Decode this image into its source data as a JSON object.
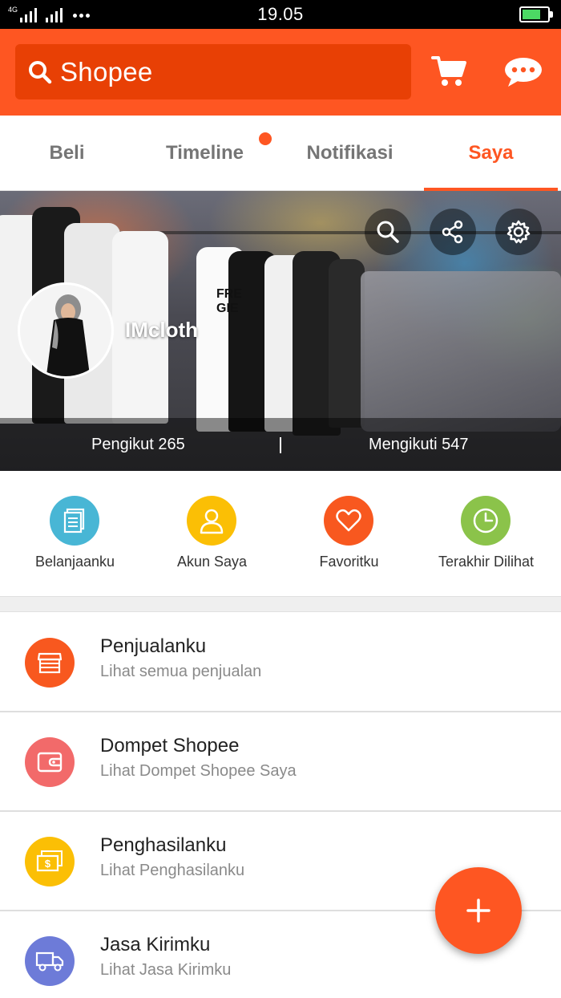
{
  "status_bar": {
    "network": "4G",
    "time": "19.05"
  },
  "header": {
    "search_label": "Shopee"
  },
  "tabs": [
    {
      "label": "Beli"
    },
    {
      "label": "Timeline"
    },
    {
      "label": "Notifikasi"
    },
    {
      "label": "Saya"
    }
  ],
  "profile": {
    "shop_name": "IMcloth",
    "followers": "Pengikut 265",
    "following": "Mengikuti 547"
  },
  "quick_actions": [
    {
      "label": "Belanjaanku",
      "icon": "document-icon",
      "color": "#48b6d5"
    },
    {
      "label": "Akun Saya",
      "icon": "person-icon",
      "color": "#fbbf05"
    },
    {
      "label": "Favoritku",
      "icon": "heart-icon",
      "color": "#f8581f"
    },
    {
      "label": "Terakhir Dilihat",
      "icon": "clock-icon",
      "color": "#8bc34a"
    }
  ],
  "menu": [
    {
      "title": "Penjualanku",
      "subtitle": "Lihat semua penjualan",
      "icon": "shop-icon",
      "color": "#f8581f"
    },
    {
      "title": "Dompet Shopee",
      "subtitle": "Lihat Dompet Shopee Saya",
      "icon": "wallet-icon",
      "color": "#f26a6a"
    },
    {
      "title": "Penghasilanku",
      "subtitle": "Lihat Penghasilanku",
      "icon": "money-icon",
      "color": "#fbbf05"
    },
    {
      "title": "Jasa Kirimku",
      "subtitle": "Lihat Jasa Kirimku",
      "icon": "truck-icon",
      "color": "#6d7bd8"
    }
  ],
  "colors": {
    "brand": "#fe5622",
    "brand_dark": "#e84005"
  }
}
